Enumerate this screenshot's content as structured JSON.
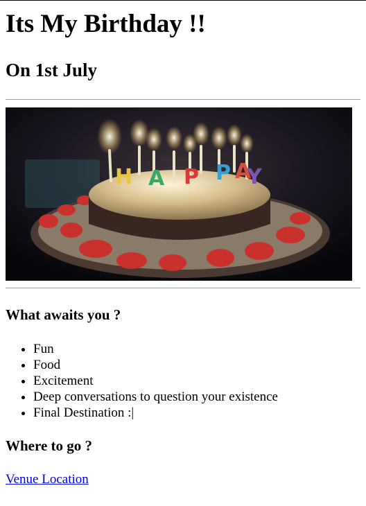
{
  "heading": "Its My Birthday !!",
  "subheading": "On 1st July",
  "hero_image": {
    "icon": "birthday-cake-image",
    "candle_letters": "HAPPY"
  },
  "awaits": {
    "title": "What awaits you ?",
    "items": [
      "Fun",
      "Food",
      "Excitement",
      "Deep conversations to question your existence",
      "Final Destination :|"
    ]
  },
  "where": {
    "title": "Where to go ?",
    "link_label": "Venue Location"
  },
  "colors": {
    "link": "#0000ee",
    "rule": "#9a9a9a"
  }
}
